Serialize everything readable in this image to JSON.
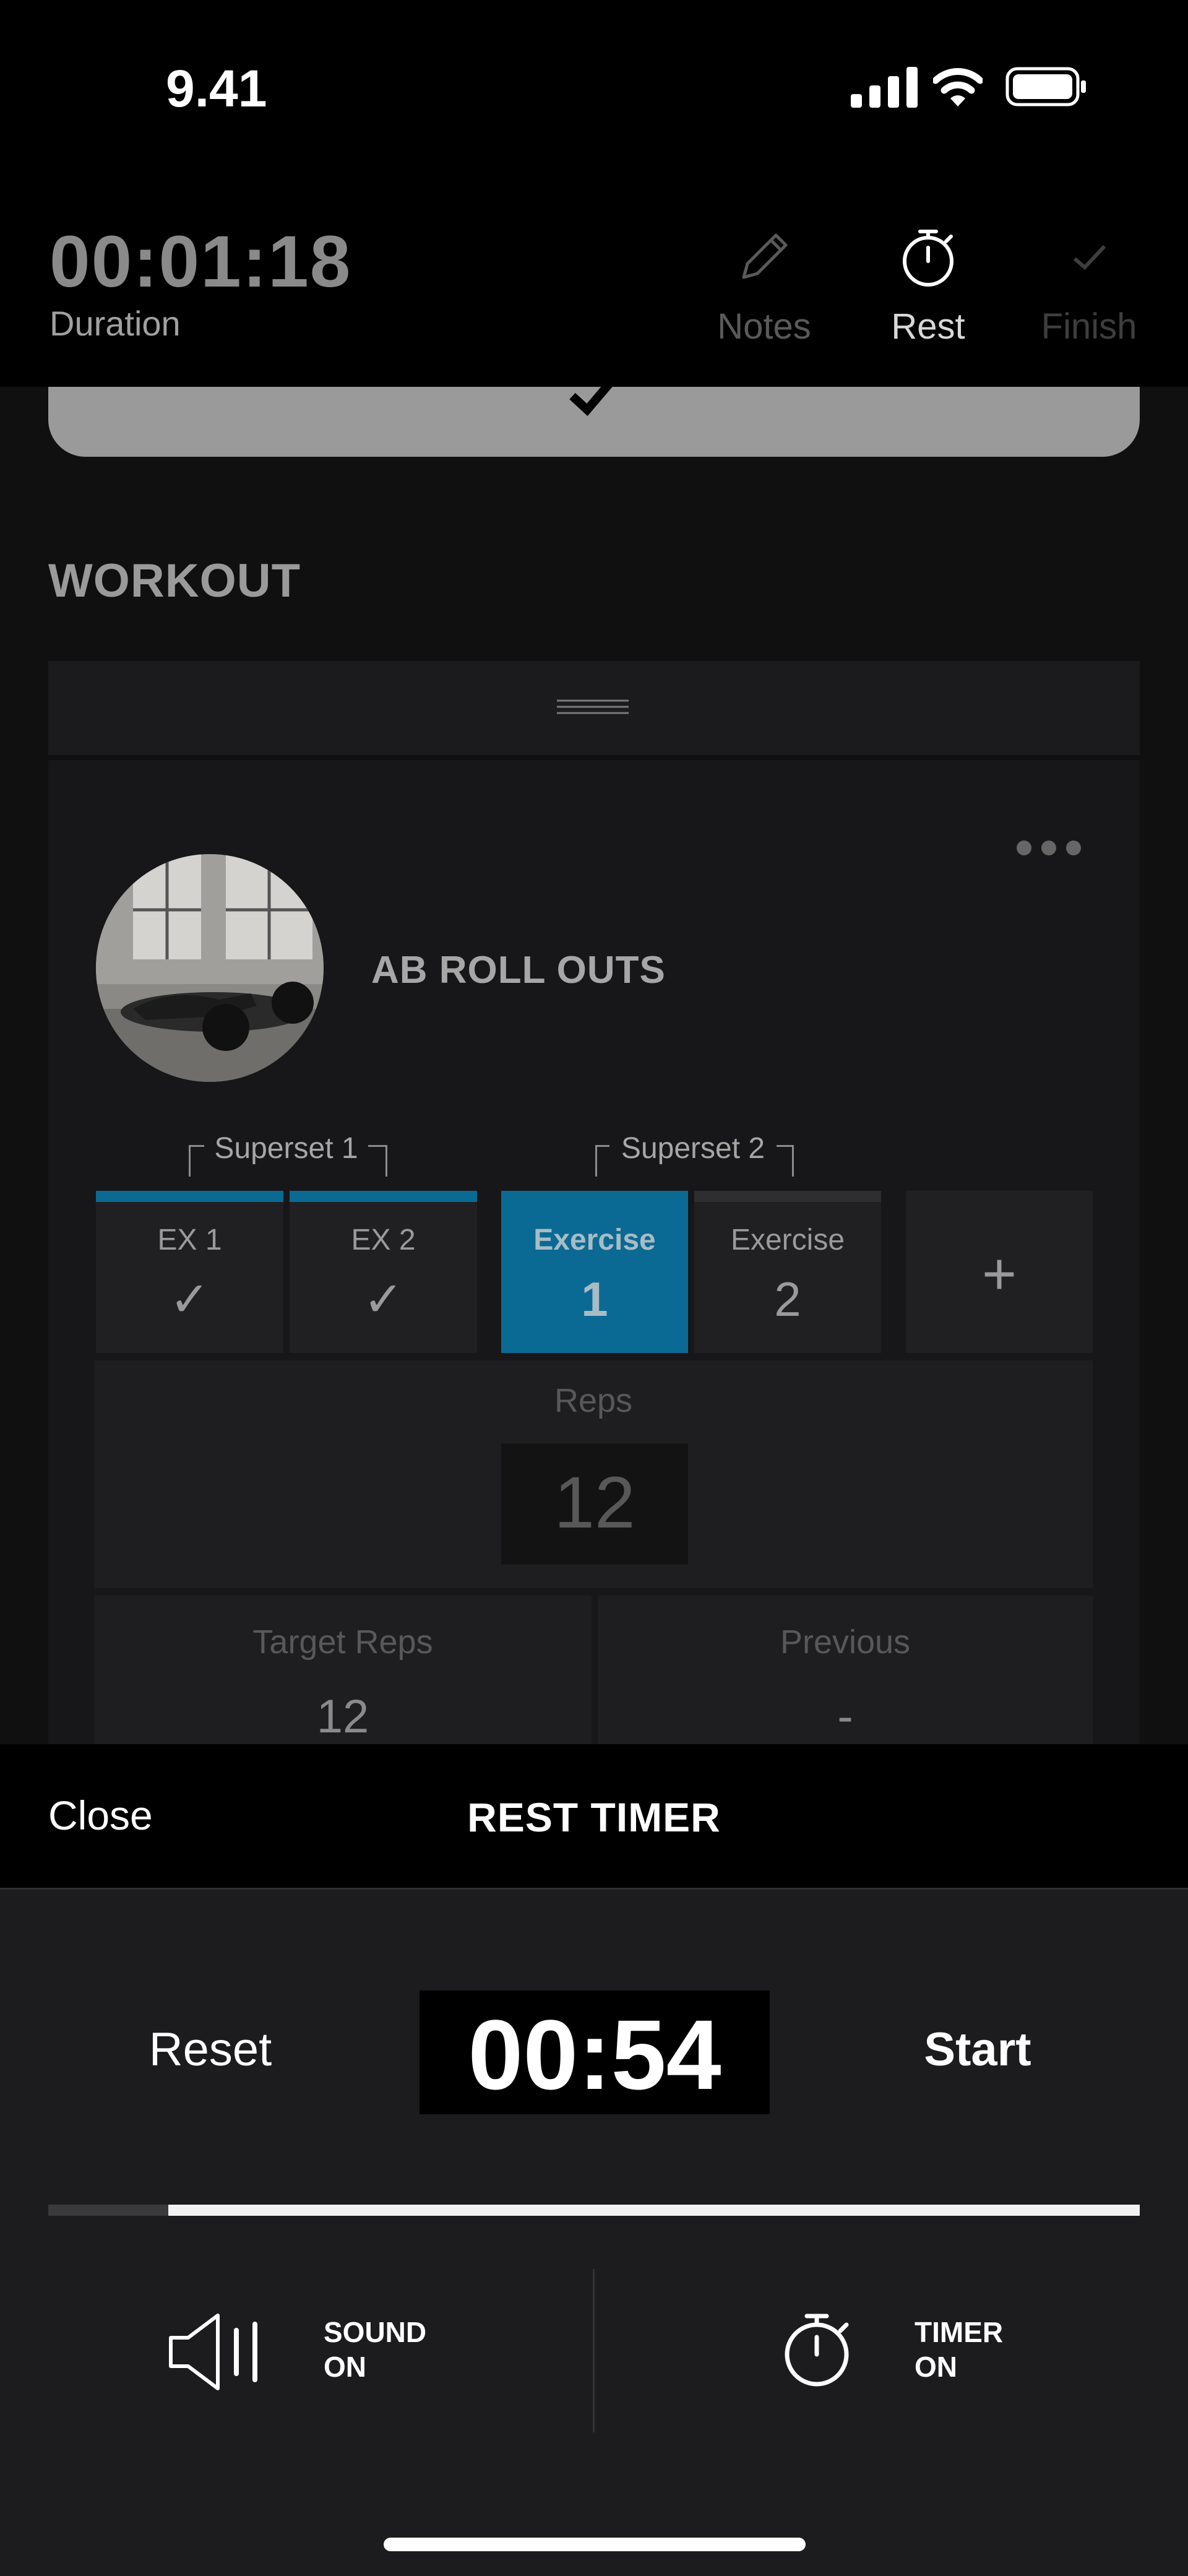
{
  "status_bar": {
    "time": "9.41"
  },
  "header": {
    "duration_value": "00:01:18",
    "duration_label": "Duration",
    "notes_label": "Notes",
    "rest_label": "Rest",
    "finish_label": "Finish"
  },
  "workout": {
    "section_title": "WORKOUT",
    "exercise_name": "AB ROLL OUTS",
    "supersets": [
      {
        "label": "Superset 1"
      },
      {
        "label": "Superset 2"
      }
    ],
    "tiles": [
      {
        "line1": "EX 1",
        "line2": "✓",
        "state": "done"
      },
      {
        "line1": "EX 2",
        "line2": "✓",
        "state": "done"
      },
      {
        "line1": "Exercise",
        "line2": "1",
        "state": "active"
      },
      {
        "line1": "Exercise",
        "line2": "2",
        "state": "pending"
      },
      {
        "line1": "",
        "line2": "+",
        "state": "add"
      }
    ],
    "reps_label": "Reps",
    "reps_value": "12",
    "target_reps_label": "Target Reps",
    "target_reps_value": "12",
    "previous_label": "Previous",
    "previous_value": "-"
  },
  "rest_timer": {
    "close_label": "Close",
    "title": "REST TIMER",
    "reset_label": "Reset",
    "time_value": "00:54",
    "start_label": "Start",
    "progress_remaining": 0.89,
    "sound_line1": "SOUND",
    "sound_line2": "ON",
    "timer_line1": "TIMER",
    "timer_line2": "ON"
  },
  "colors": {
    "accent": "#0a6a94",
    "sheet_bg": "#1c1c1e",
    "progress_fill": "#f2f2f2"
  }
}
